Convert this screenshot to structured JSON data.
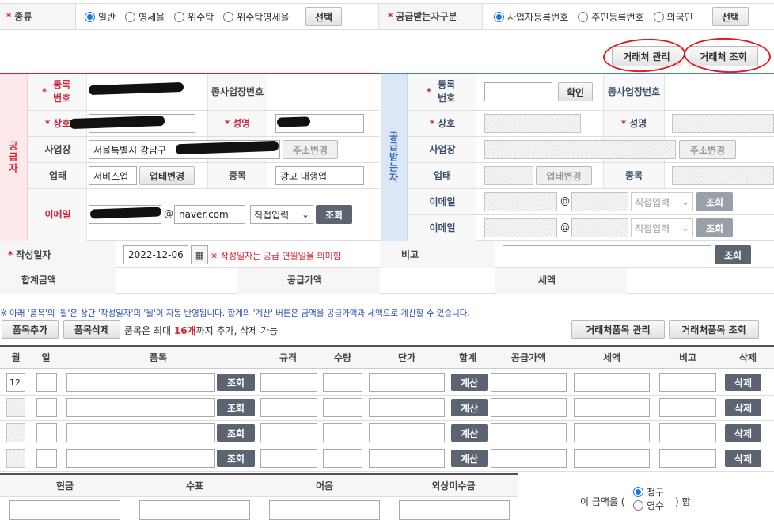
{
  "top": {
    "kind_label": "종류",
    "kind_options": [
      {
        "label": "일반",
        "checked": true
      },
      {
        "label": "영세율",
        "checked": false
      },
      {
        "label": "위수탁",
        "checked": false
      },
      {
        "label": "위수탁영세율",
        "checked": false
      }
    ],
    "kind_select": "선택",
    "recv_label": "공급받는자구분",
    "recv_options": [
      {
        "label": "사업자등록번호",
        "checked": true
      },
      {
        "label": "주민등록번호",
        "checked": false
      },
      {
        "label": "외국인",
        "checked": false
      }
    ],
    "recv_select": "선택",
    "partner_manage": "거래처 관리",
    "partner_lookup": "거래처 조회"
  },
  "supplier": {
    "side_label": "공급자",
    "reg_label": "등록번호",
    "branch_label": "종사업장번호",
    "name_label": "상호",
    "ceo_label": "성명",
    "addr_label": "사업장",
    "addr_value": "서울특별시 강남구",
    "addr_btn": "주소변경",
    "biztype_label": "업태",
    "biztype_value": "서비스업",
    "biztype_btn": "업태변경",
    "item_label": "종목",
    "item_value": "광고 대행업",
    "email_label": "이메일",
    "email_at": "@",
    "email_domain": "naver.com",
    "email_select": "직접입력",
    "email_btn": "조회"
  },
  "receiver": {
    "side_label": "공급받는자",
    "reg_label": "등록번호",
    "confirm_btn": "확인",
    "branch_label": "종사업장번호",
    "name_label": "상호",
    "ceo_label": "성명",
    "addr_label": "사업장",
    "addr_btn": "주소변경",
    "biztype_label": "업태",
    "biztype_btn": "업태변경",
    "item_label": "종목",
    "email_label": "이메일",
    "email_at": "@",
    "email_select": "직접입력",
    "email_btn": "조회"
  },
  "date": {
    "label": "작성일자",
    "value": "2022-12-06",
    "note": "※ 작성일자는 공급 연월일을 의미함",
    "remark_label": "비고",
    "remark_btn": "조회"
  },
  "totals": {
    "sum_label": "합계금액",
    "supply_label": "공급가액",
    "tax_label": "세액"
  },
  "notice": "※ 아래 '품목'의 '월'은 상단 '작성일자'의 '월'이 자동 반영됩니다. 합계의 '계산' 버튼은 금액을 공급가액과 세액으로 계산할 수 있습니다.",
  "items_toolbar": {
    "add": "품목추가",
    "delete": "품목삭제",
    "info_pre": "품목은 최대 ",
    "info_num": "16개",
    "info_post": "까지 추가, 삭제 가능",
    "manage": "거래처품목 관리",
    "lookup": "거래처품목 조회"
  },
  "grid": {
    "headers": [
      "월",
      "일",
      "품목",
      "규격",
      "수량",
      "단가",
      "합계",
      "공급가액",
      "세액",
      "비고",
      "삭제"
    ],
    "rows": [
      {
        "month": "12"
      },
      {
        "month": ""
      },
      {
        "month": ""
      },
      {
        "month": ""
      }
    ],
    "lookup_btn": "조회",
    "calc_btn": "계산",
    "delete_btn": "삭제"
  },
  "payment": {
    "headers": [
      "현금",
      "수표",
      "어음",
      "외상미수금"
    ],
    "amount_pre": "이 금액을 (",
    "options": [
      {
        "label": "청구",
        "checked": true
      },
      {
        "label": "영수",
        "checked": false
      }
    ],
    "amount_post": ") 함"
  },
  "colors": {
    "supplier": "#d8222c",
    "receiver": "#3f7fd6",
    "supplier_bg": "#fde9ec",
    "receiver_bg": "#dbe6f7",
    "annotation": "#e01b24"
  }
}
